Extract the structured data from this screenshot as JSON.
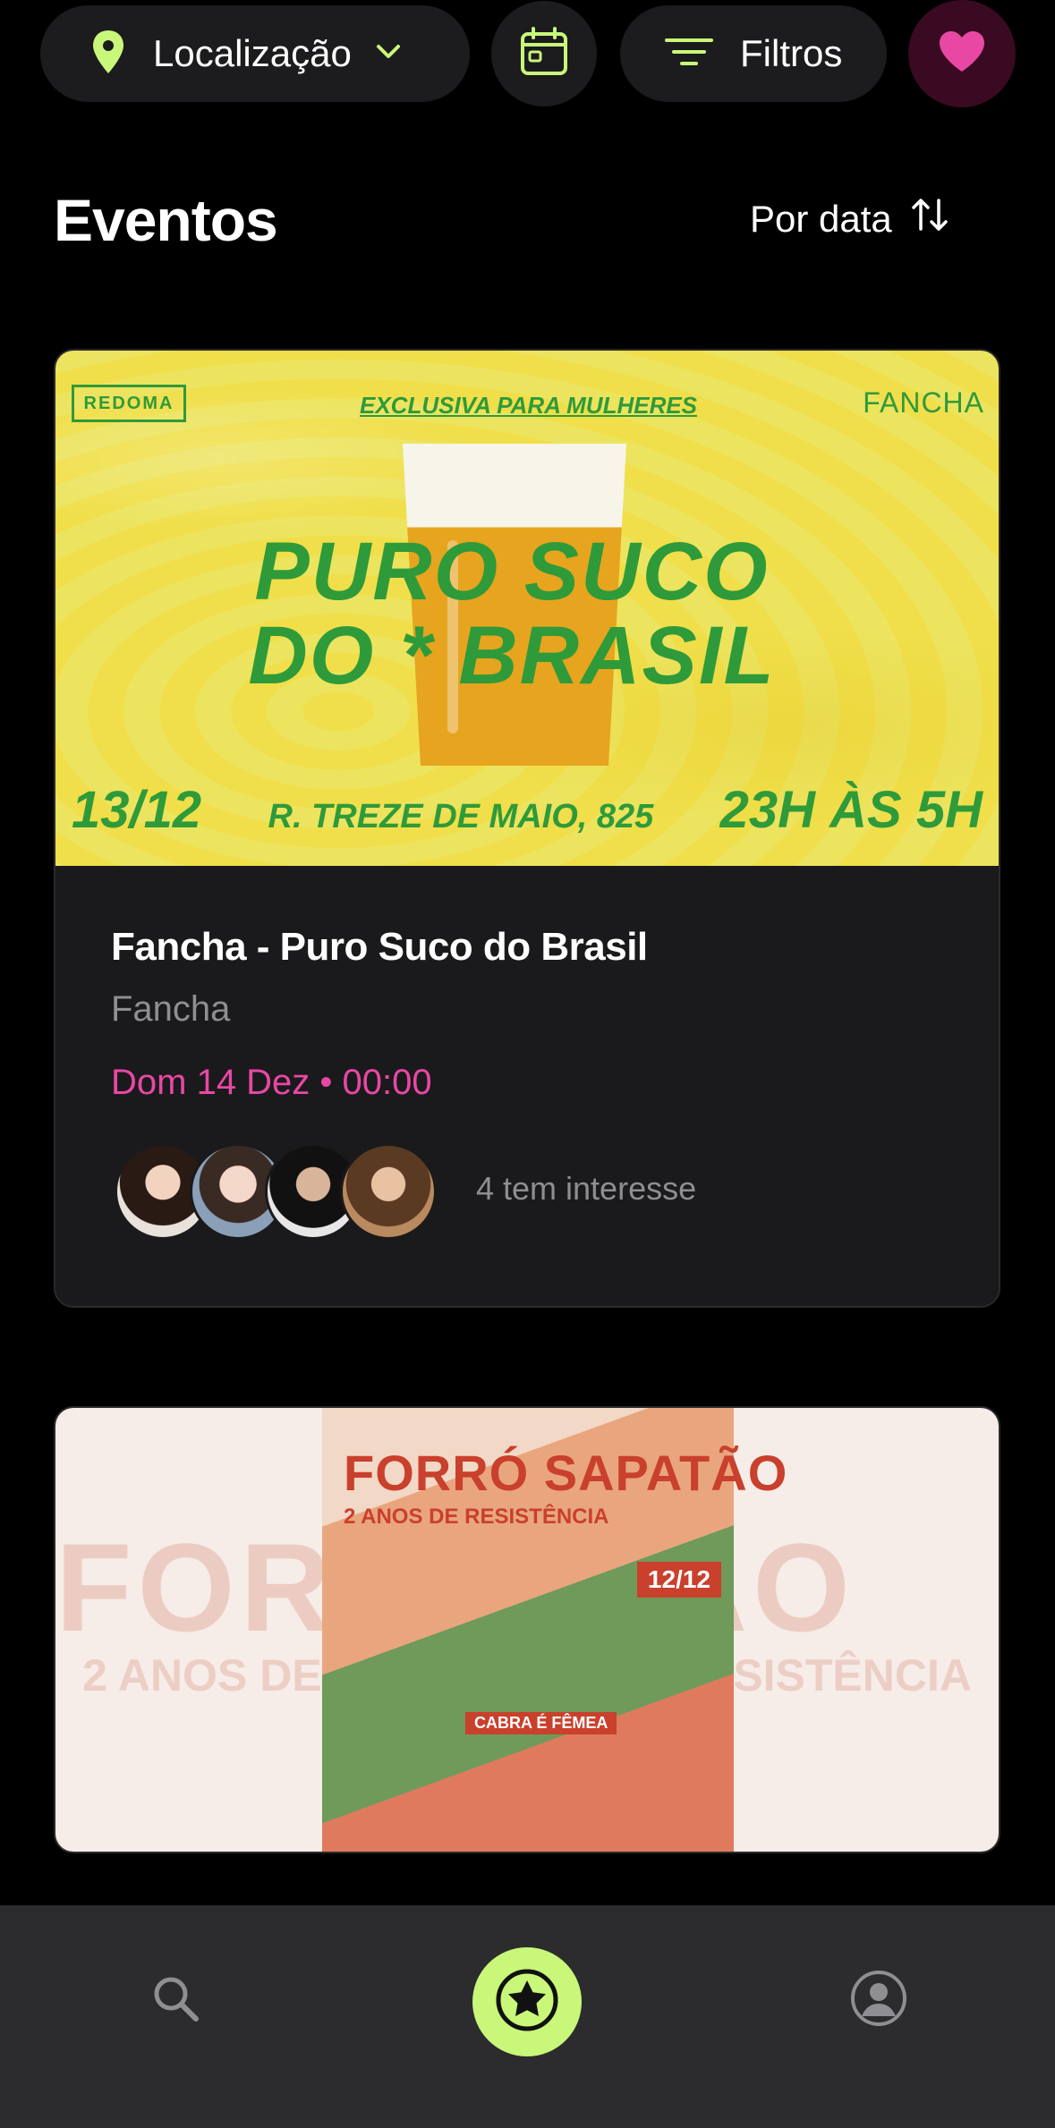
{
  "topbar": {
    "location_label": "Localização",
    "filters_label": "Filtros",
    "colors": {
      "pill_bg": "#1c1c1e",
      "accent_green": "#c9f77a",
      "favorite_pink": "#e848a4"
    },
    "icons": [
      "location-pin-icon",
      "chevron-down-icon",
      "calendar-icon",
      "filter-lines-icon",
      "heart-icon"
    ]
  },
  "header": {
    "title": "Eventos",
    "sort_label": "Por data",
    "sort_icon": "sort-arrows-icon"
  },
  "events": [
    {
      "poster": {
        "badge": "REDOMA",
        "subtitle": "EXCLUSIVA PARA MULHERES",
        "brand": "FANCHA",
        "headline_line1": "PURO SUCO",
        "headline_line2": "DO * BRASIL",
        "date": "13/12",
        "address": "R. TREZE DE MAIO, 825",
        "time": "23H ÀS 5H"
      },
      "title": "Fancha - Puro Suco do Brasil",
      "organizer": "Fancha",
      "datetime": "Dom 14 Dez • 00:00",
      "interest_text": "4 tem interesse",
      "interested_count": 4
    },
    {
      "poster": {
        "title": "FORRÓ SAPATÃO",
        "subtitle": "2 ANOS DE RESISTÊNCIA",
        "date": "12/12",
        "tag": "CABRA É FÊMEA",
        "bg_text": "FORRÓ      TÃO",
        "bg_sub_left": "2 ANOS DE",
        "bg_sub_right": "RESISTÊNCIA"
      }
    }
  ],
  "bottomnav": {
    "items": [
      "search-icon",
      "star-home-icon",
      "profile-icon"
    ],
    "active_color": "#c9f77a"
  }
}
